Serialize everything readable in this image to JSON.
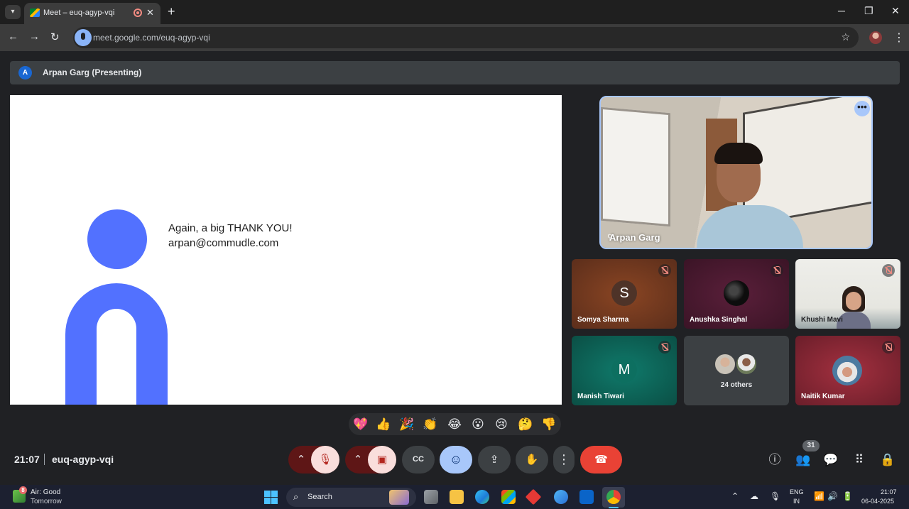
{
  "browser": {
    "tab_title": "Meet – euq-agyp-vqi",
    "url": "meet.google.com/euq-agyp-vqi",
    "new_tab": "+",
    "close_tab": "✕",
    "icons": [
      "tab-search-icon",
      "meet-favicon-icon",
      "recording-icon",
      "back-icon",
      "forward-icon",
      "reload-icon",
      "mic-icon",
      "star-icon",
      "profile-avatar",
      "kebab-menu-icon",
      "minimize-icon",
      "maximize-icon",
      "close-icon"
    ]
  },
  "presenting": {
    "avatar_letter": "A",
    "label": "Arpan Garg (Presenting)"
  },
  "slide": {
    "line1": "Again, a big THANK YOU!",
    "line2": "arpan@commudle.com",
    "accent_color": "#5271ff"
  },
  "participants": {
    "main": {
      "name": "Arpan Garg",
      "more": "•••"
    },
    "tiles": [
      {
        "name": "Somya Sharma",
        "avatar": "S",
        "muted": true
      },
      {
        "name": "Anushka Singhal",
        "muted": true
      },
      {
        "name": "Khushi Mavi",
        "muted": true
      },
      {
        "name": "Manish Tiwari",
        "avatar": "M",
        "muted": true
      },
      {
        "name": "24 others"
      },
      {
        "name": "Naitik Kumar",
        "muted": true
      }
    ]
  },
  "reactions": [
    "💖",
    "👍",
    "🎉",
    "👏",
    "😂",
    "😮",
    "😢",
    "🤔",
    "👎"
  ],
  "meeting": {
    "time": "21:07",
    "code": "euq-agyp-vqi",
    "people_count": "31"
  },
  "controls": {
    "icons": [
      "mic-options-chevron-icon",
      "mic-off-icon",
      "camera-options-chevron-icon",
      "camera-off-icon",
      "captions-icon",
      "emoji-icon",
      "present-screen-icon",
      "raise-hand-icon",
      "more-options-icon",
      "hang-up-icon"
    ],
    "glyphs": {
      "chevron": "⌃",
      "mic_off": "🎙",
      "cam_off": "▣",
      "captions": "CC",
      "emoji": "☺",
      "present": "⇪",
      "hand": "✋",
      "more": "⋮",
      "hangup": "☎"
    }
  },
  "side_panel": {
    "icons": [
      "info-icon",
      "people-icon",
      "chat-icon",
      "activities-icon",
      "host-controls-icon"
    ],
    "glyphs": {
      "info": "ⓘ",
      "people": "👥",
      "chat": "💬",
      "activities": "⠿",
      "lock": "🔒"
    }
  },
  "taskbar": {
    "weather_line1": "Air: Good",
    "weather_line2": "Tomorrow",
    "weather_badge": "8",
    "search_label": "Search",
    "lang_line1": "ENG",
    "lang_line2": "IN",
    "clock_time": "21:07",
    "clock_date": "06-04-2025",
    "colors": {
      "taskbar": "#1c2030",
      "accent": "#4cc2ff"
    }
  }
}
